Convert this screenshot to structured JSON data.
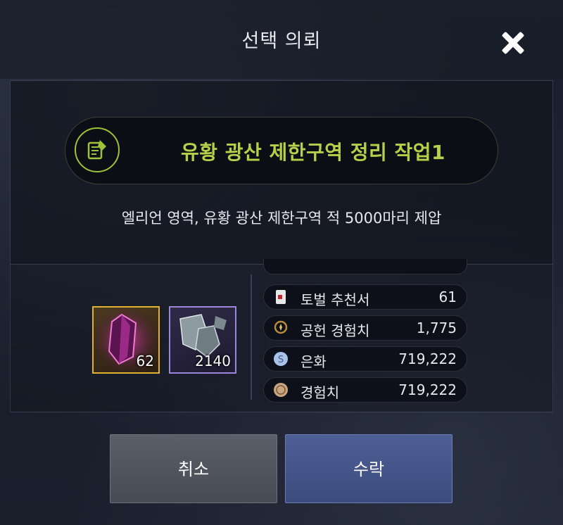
{
  "dialog": {
    "title": "선택 의뢰",
    "close_icon": "close-icon"
  },
  "quest": {
    "name": "유황 광산 제한구역 정리 작업1",
    "icon": "quest-scroll-icon",
    "description": "엘리언 영역, 유황 광산 제한구역 적 5000마리 제압"
  },
  "items": [
    {
      "icon": "purple-crystal-icon",
      "count": "62",
      "rarity_color": "#e0b132"
    },
    {
      "icon": "ore-chunk-icon",
      "count": "2140",
      "rarity_color": "#9c86d8"
    }
  ],
  "rewards": [
    {
      "icon": "subjugation-scroll-icon",
      "label": "토벌 추천서",
      "value": "61"
    },
    {
      "icon": "contribution-medal-icon",
      "label": "공헌 경험치",
      "value": "1,775"
    },
    {
      "icon": "silver-coin-icon",
      "label": "은화",
      "value": "719,222"
    },
    {
      "icon": "exp-coin-icon",
      "label": "경험치",
      "value": "719,222"
    }
  ],
  "buttons": {
    "cancel": "취소",
    "accept": "수락"
  },
  "colors": {
    "quest_name": "#b5d14a",
    "accept_button": "#4d5f95",
    "cancel_button": "#5a5f69"
  }
}
